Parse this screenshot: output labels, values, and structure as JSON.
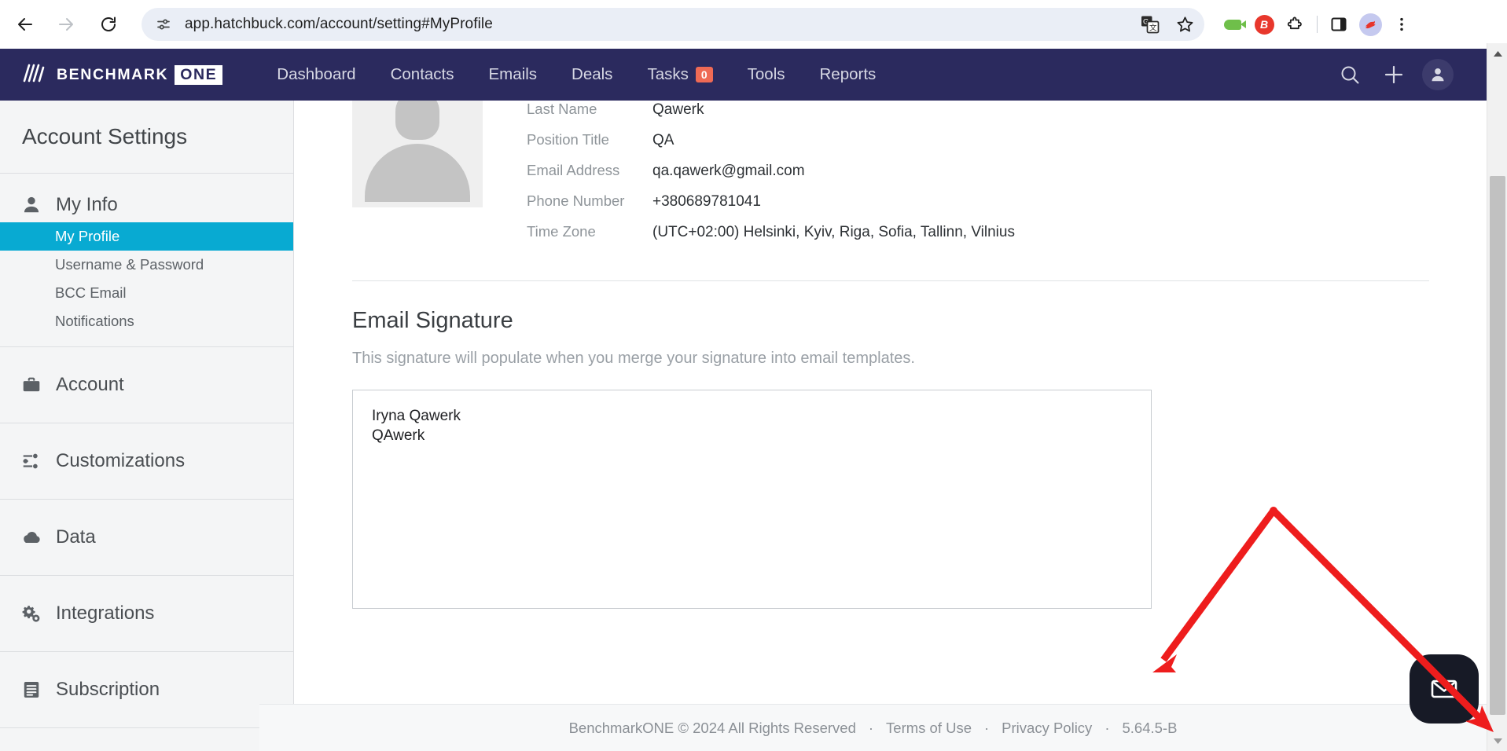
{
  "browser": {
    "url": "app.hatchbuck.com/account/setting#MyProfile",
    "back_label": "Back",
    "forward_label": "Forward",
    "reload_label": "Reload",
    "site_info_label": "View site information",
    "translate_label": "Translate this page",
    "bookmark_label": "Bookmark this tab",
    "ext_fish_label": "Extension",
    "ext_b_label": "B",
    "ext_puzzle_label": "Extensions",
    "side_panel_label": "Side panel",
    "profile_label": "Profile",
    "menu_label": "Customize and control Chrome"
  },
  "appnav": {
    "brand_text": "BENCHMARK",
    "brand_badge": "ONE",
    "items": [
      {
        "label": "Dashboard",
        "badge": null
      },
      {
        "label": "Contacts",
        "badge": null
      },
      {
        "label": "Emails",
        "badge": null
      },
      {
        "label": "Deals",
        "badge": null
      },
      {
        "label": "Tasks",
        "badge": "0"
      },
      {
        "label": "Tools",
        "badge": null
      },
      {
        "label": "Reports",
        "badge": null
      }
    ],
    "search_label": "Search",
    "add_label": "Add",
    "account_label": "Account"
  },
  "sidebar": {
    "title": "Account Settings",
    "groups": [
      {
        "head": "My Info",
        "icon": "person-icon",
        "items": [
          {
            "label": "My Profile",
            "active": true
          },
          {
            "label": "Username & Password",
            "active": false
          },
          {
            "label": "BCC Email",
            "active": false
          },
          {
            "label": "Notifications",
            "active": false
          }
        ]
      },
      {
        "head": "Account",
        "icon": "briefcase-icon",
        "items": []
      },
      {
        "head": "Customizations",
        "icon": "sliders-icon",
        "items": []
      },
      {
        "head": "Data",
        "icon": "cloud-icon",
        "items": []
      },
      {
        "head": "Integrations",
        "icon": "gears-icon",
        "items": []
      },
      {
        "head": "Subscription",
        "icon": "document-icon",
        "items": []
      }
    ]
  },
  "profile": {
    "avatar_alt": "Profile photo placeholder",
    "fields": [
      {
        "label": "Last Name",
        "value": "Qawerk"
      },
      {
        "label": "Position Title",
        "value": "QA"
      },
      {
        "label": "Email Address",
        "value": "qa.qawerk@gmail.com"
      },
      {
        "label": "Phone Number",
        "value": "+380689781041"
      },
      {
        "label": "Time Zone",
        "value": "(UTC+02:00) Helsinki, Kyiv, Riga, Sofia, Tallinn, Vilnius"
      }
    ]
  },
  "signature": {
    "title": "Email Signature",
    "description": "This signature will populate when you merge your signature into email templates.",
    "value": "Iryna Qawerk\nQAwerk",
    "placeholder": ""
  },
  "footer": {
    "copyright": "BenchmarkONE © 2024 All Rights Reserved",
    "terms": "Terms of Use",
    "privacy": "Privacy Policy",
    "version": "5.64.5-B",
    "separator": "·"
  },
  "chat": {
    "label": "Open chat",
    "icon": "envelope-icon"
  },
  "colors": {
    "nav_bg": "#2b2a5e",
    "accent": "#08aad2",
    "badge": "#ef6a55",
    "annotation": "#ee1d1d",
    "chat_bg": "#171a26"
  },
  "scrollbar": {
    "up_label": "Scroll up",
    "down_label": "Scroll down",
    "thumb_label": "Vertical scrollbar"
  }
}
